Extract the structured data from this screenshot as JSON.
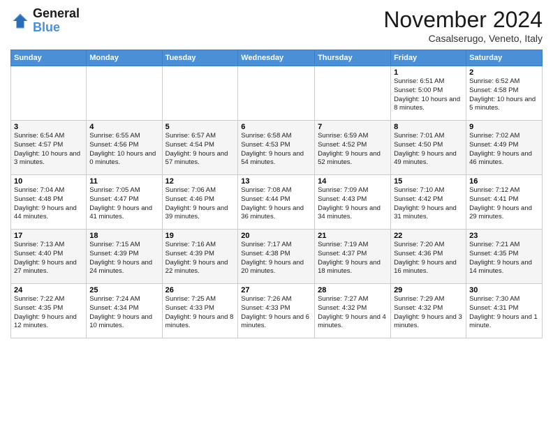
{
  "logo": {
    "line1": "General",
    "line2": "Blue"
  },
  "title": "November 2024",
  "location": "Casalserugo, Veneto, Italy",
  "days_of_week": [
    "Sunday",
    "Monday",
    "Tuesday",
    "Wednesday",
    "Thursday",
    "Friday",
    "Saturday"
  ],
  "weeks": [
    [
      {
        "day": "",
        "info": ""
      },
      {
        "day": "",
        "info": ""
      },
      {
        "day": "",
        "info": ""
      },
      {
        "day": "",
        "info": ""
      },
      {
        "day": "",
        "info": ""
      },
      {
        "day": "1",
        "info": "Sunrise: 6:51 AM\nSunset: 5:00 PM\nDaylight: 10 hours and 8 minutes."
      },
      {
        "day": "2",
        "info": "Sunrise: 6:52 AM\nSunset: 4:58 PM\nDaylight: 10 hours and 5 minutes."
      }
    ],
    [
      {
        "day": "3",
        "info": "Sunrise: 6:54 AM\nSunset: 4:57 PM\nDaylight: 10 hours and 3 minutes."
      },
      {
        "day": "4",
        "info": "Sunrise: 6:55 AM\nSunset: 4:56 PM\nDaylight: 10 hours and 0 minutes."
      },
      {
        "day": "5",
        "info": "Sunrise: 6:57 AM\nSunset: 4:54 PM\nDaylight: 9 hours and 57 minutes."
      },
      {
        "day": "6",
        "info": "Sunrise: 6:58 AM\nSunset: 4:53 PM\nDaylight: 9 hours and 54 minutes."
      },
      {
        "day": "7",
        "info": "Sunrise: 6:59 AM\nSunset: 4:52 PM\nDaylight: 9 hours and 52 minutes."
      },
      {
        "day": "8",
        "info": "Sunrise: 7:01 AM\nSunset: 4:50 PM\nDaylight: 9 hours and 49 minutes."
      },
      {
        "day": "9",
        "info": "Sunrise: 7:02 AM\nSunset: 4:49 PM\nDaylight: 9 hours and 46 minutes."
      }
    ],
    [
      {
        "day": "10",
        "info": "Sunrise: 7:04 AM\nSunset: 4:48 PM\nDaylight: 9 hours and 44 minutes."
      },
      {
        "day": "11",
        "info": "Sunrise: 7:05 AM\nSunset: 4:47 PM\nDaylight: 9 hours and 41 minutes."
      },
      {
        "day": "12",
        "info": "Sunrise: 7:06 AM\nSunset: 4:46 PM\nDaylight: 9 hours and 39 minutes."
      },
      {
        "day": "13",
        "info": "Sunrise: 7:08 AM\nSunset: 4:44 PM\nDaylight: 9 hours and 36 minutes."
      },
      {
        "day": "14",
        "info": "Sunrise: 7:09 AM\nSunset: 4:43 PM\nDaylight: 9 hours and 34 minutes."
      },
      {
        "day": "15",
        "info": "Sunrise: 7:10 AM\nSunset: 4:42 PM\nDaylight: 9 hours and 31 minutes."
      },
      {
        "day": "16",
        "info": "Sunrise: 7:12 AM\nSunset: 4:41 PM\nDaylight: 9 hours and 29 minutes."
      }
    ],
    [
      {
        "day": "17",
        "info": "Sunrise: 7:13 AM\nSunset: 4:40 PM\nDaylight: 9 hours and 27 minutes."
      },
      {
        "day": "18",
        "info": "Sunrise: 7:15 AM\nSunset: 4:39 PM\nDaylight: 9 hours and 24 minutes."
      },
      {
        "day": "19",
        "info": "Sunrise: 7:16 AM\nSunset: 4:39 PM\nDaylight: 9 hours and 22 minutes."
      },
      {
        "day": "20",
        "info": "Sunrise: 7:17 AM\nSunset: 4:38 PM\nDaylight: 9 hours and 20 minutes."
      },
      {
        "day": "21",
        "info": "Sunrise: 7:19 AM\nSunset: 4:37 PM\nDaylight: 9 hours and 18 minutes."
      },
      {
        "day": "22",
        "info": "Sunrise: 7:20 AM\nSunset: 4:36 PM\nDaylight: 9 hours and 16 minutes."
      },
      {
        "day": "23",
        "info": "Sunrise: 7:21 AM\nSunset: 4:35 PM\nDaylight: 9 hours and 14 minutes."
      }
    ],
    [
      {
        "day": "24",
        "info": "Sunrise: 7:22 AM\nSunset: 4:35 PM\nDaylight: 9 hours and 12 minutes."
      },
      {
        "day": "25",
        "info": "Sunrise: 7:24 AM\nSunset: 4:34 PM\nDaylight: 9 hours and 10 minutes."
      },
      {
        "day": "26",
        "info": "Sunrise: 7:25 AM\nSunset: 4:33 PM\nDaylight: 9 hours and 8 minutes."
      },
      {
        "day": "27",
        "info": "Sunrise: 7:26 AM\nSunset: 4:33 PM\nDaylight: 9 hours and 6 minutes."
      },
      {
        "day": "28",
        "info": "Sunrise: 7:27 AM\nSunset: 4:32 PM\nDaylight: 9 hours and 4 minutes."
      },
      {
        "day": "29",
        "info": "Sunrise: 7:29 AM\nSunset: 4:32 PM\nDaylight: 9 hours and 3 minutes."
      },
      {
        "day": "30",
        "info": "Sunrise: 7:30 AM\nSunset: 4:31 PM\nDaylight: 9 hours and 1 minute."
      }
    ]
  ]
}
